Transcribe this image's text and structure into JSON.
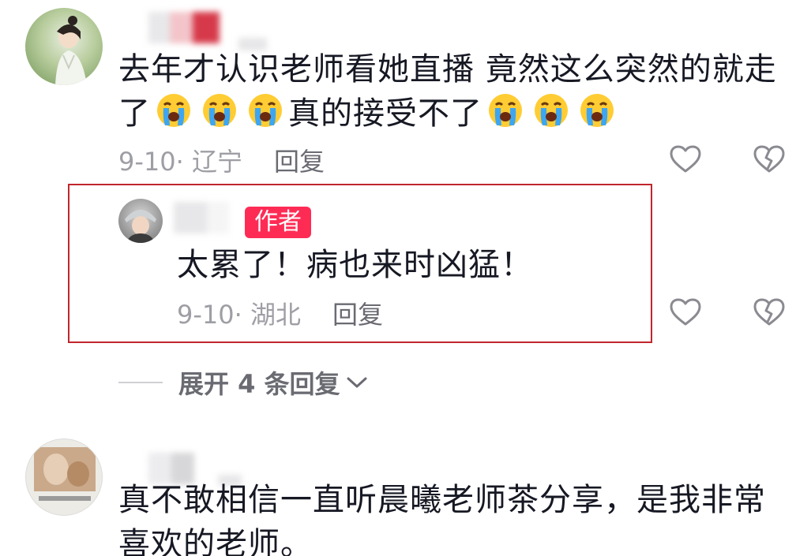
{
  "comments": [
    {
      "text_line1": "去年才认识老师看她直播 竟然这么突然的就走",
      "text_line2_prefix": "了",
      "text_line2_middle": "真的接受不了",
      "date": "9-10",
      "location": "· 辽宁",
      "reply_label": "回复",
      "reply": {
        "badge": "作者",
        "text": "太累了！病也来时凶猛！",
        "date": "9-10",
        "location": "· 湖北",
        "reply_label": "回复"
      },
      "expand_label": "展开 4 条回复"
    },
    {
      "text_line1": "真不敢相信一直听晨曦老师茶分享，是我非常",
      "text_line2": "喜欢的老师。"
    }
  ],
  "icons": {
    "like": "heart-outline-icon",
    "dislike": "broken-heart-icon",
    "emoji": "loudly-crying-face-icon",
    "expand": "chevron-down-icon"
  },
  "colors": {
    "accent": "#fe2c55",
    "highlight_border": "#c0262c",
    "meta_text": "#9e9fa5"
  }
}
